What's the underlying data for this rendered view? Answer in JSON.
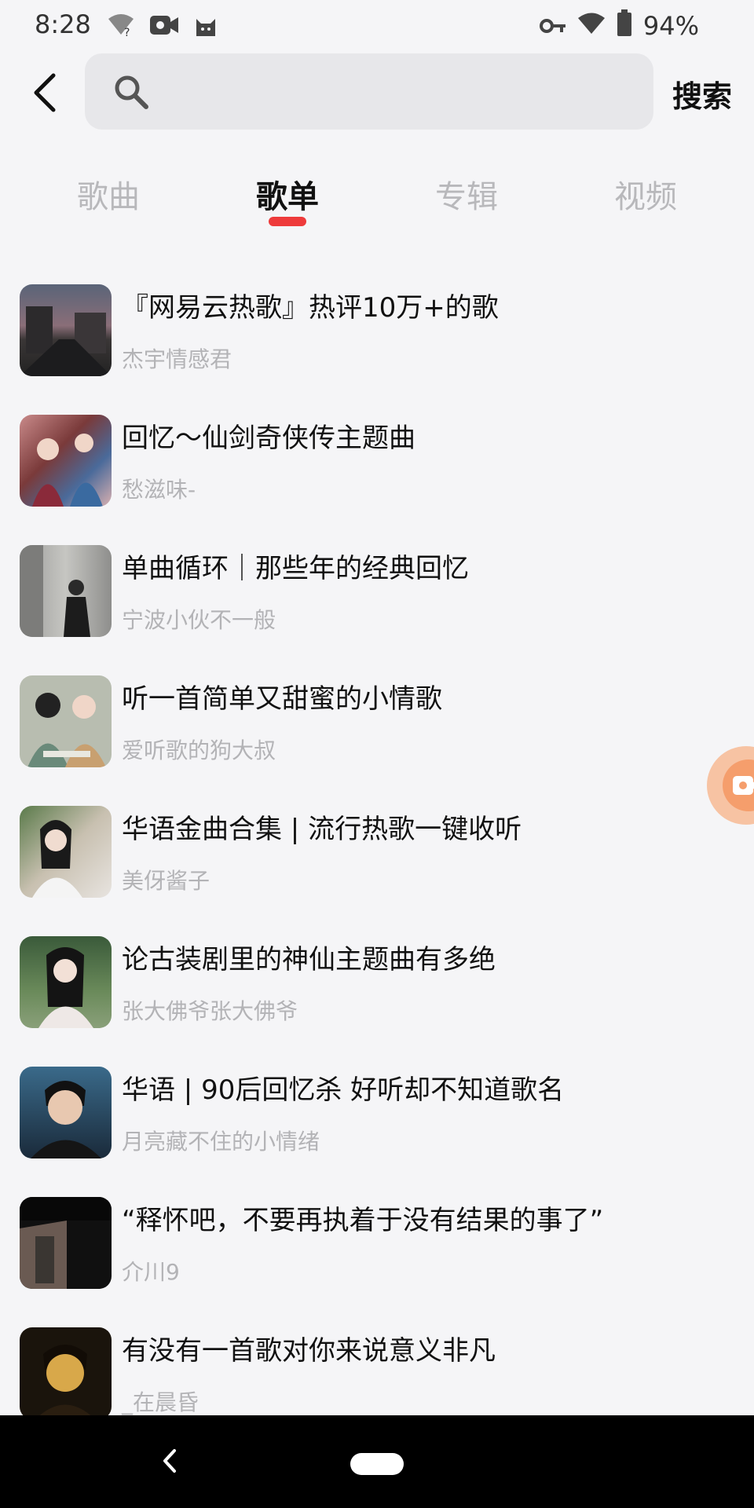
{
  "status_bar": {
    "time": "8:28",
    "battery": "94%",
    "icons": [
      "wifi-question-icon",
      "video-camera-icon",
      "cat-icon",
      "key-icon",
      "wifi-icon",
      "battery-icon"
    ]
  },
  "header": {
    "search_placeholder": "",
    "search_button": "搜索"
  },
  "tabs": [
    {
      "label": "歌曲",
      "active": false
    },
    {
      "label": "歌单",
      "active": true
    },
    {
      "label": "专辑",
      "active": false
    },
    {
      "label": "视频",
      "active": false
    }
  ],
  "colors": {
    "accent": "#ee3b3b",
    "title": "#111111",
    "subtitle": "#b3b3b6",
    "float_button": "#f59e6c"
  },
  "playlists": [
    {
      "title": "『网易云热歌』热评10万+的歌",
      "creator": "杰宇情感君"
    },
    {
      "title": "回忆～仙剑奇侠传主题曲",
      "creator": "愁滋味-"
    },
    {
      "title": "单曲循环｜那些年的经典回忆",
      "creator": "宁波小伙不一般"
    },
    {
      "title": "听一首简单又甜蜜的小情歌",
      "creator": "爱听歌的狗大叔"
    },
    {
      "title": "华语金曲合集 | 流行热歌一键收听",
      "creator": "美伢酱子"
    },
    {
      "title": "论古装剧里的神仙主题曲有多绝",
      "creator": "张大佛爷张大佛爷"
    },
    {
      "title": "华语 | 90后回忆杀 好听却不知道歌名",
      "creator": "月亮藏不住的小情绪"
    },
    {
      "title": "“释怀吧，不要再执着于没有结果的事了”",
      "creator": "介川9"
    },
    {
      "title": "有没有一首歌对你来说意义非凡",
      "creator": "_在晨昏"
    }
  ]
}
